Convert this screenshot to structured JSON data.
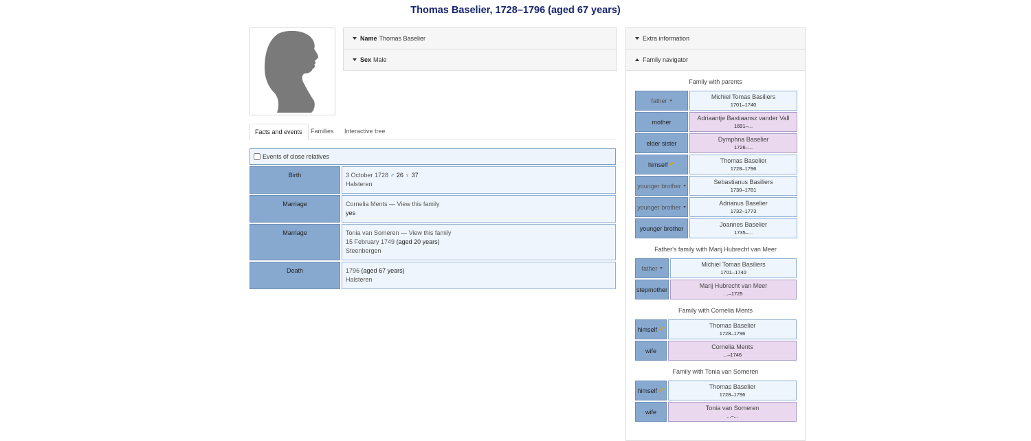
{
  "page_title": "Thomas Baselier, 1728–1796 (aged 67 years)",
  "attributes": [
    {
      "label": "Name",
      "value": "Thomas Baselier"
    },
    {
      "label": "Sex",
      "value": "Male"
    }
  ],
  "tabs": [
    "Facts and events",
    "Families",
    "Interactive tree"
  ],
  "close_relatives_label": "Events of close relatives",
  "facts": {
    "birth": {
      "label": "Birth",
      "date": "3 October 1728",
      "father_age": "26",
      "mother_age": "37",
      "place": "Halsteren"
    },
    "marriage1": {
      "label": "Marriage",
      "spouse": "Cornelia Ments",
      "sep": " — ",
      "link": "View this family",
      "status": "yes"
    },
    "marriage2": {
      "label": "Marriage",
      "spouse": "Tonia van Someren",
      "sep": " — ",
      "link": "View this family",
      "date": "15 February 1749",
      "age": "(aged 20 years)",
      "place": "Steenbergen"
    },
    "death": {
      "label": "Death",
      "date": "1796",
      "age": "(aged 67 years)",
      "place": "Halsteren"
    }
  },
  "sidebar": {
    "extra_info": "Extra information",
    "family_navigator": "Family navigator",
    "families": [
      {
        "title": "Family with parents",
        "members": [
          {
            "role": "father",
            "name": "Michiel Tomas Basiliers",
            "dates": "1701–1740"
          },
          {
            "role": "mother",
            "name": "Adriaantje Bastiaansz vander Vall",
            "dates": "1691–..."
          },
          {
            "role": "elder sister",
            "name": "Dymphna Baselier",
            "dates": "1726–..."
          },
          {
            "role": "himself",
            "name": "Thomas Baselier",
            "dates": "1728–1796"
          },
          {
            "role": "younger brother",
            "name": "Sebastianus Basiliers",
            "dates": "1730–1781"
          },
          {
            "role": "younger brother",
            "name": "Adrianus Baselier",
            "dates": "1732–1773"
          },
          {
            "role": "younger brother",
            "name": "Joannes Baselier",
            "dates": "1735–..."
          }
        ]
      },
      {
        "title": "Father's family with Marij Hubrecht van Meer",
        "members": [
          {
            "role": "father",
            "name": "Michiel Tomas Basiliers",
            "dates": "1701–1740"
          },
          {
            "role": "stepmother",
            "name": "Marij Hubrecht van Meer",
            "dates": "...–1725"
          }
        ]
      },
      {
        "title": "Family with Cornelia Ments",
        "members": [
          {
            "role": "himself",
            "name": "Thomas Baselier",
            "dates": "1728–1796"
          },
          {
            "role": "wife",
            "name": "Cornelia Ments",
            "dates": "...–1746"
          }
        ]
      },
      {
        "title": "Family with Tonia van Someren",
        "members": [
          {
            "role": "himself",
            "name": "Thomas Baselier",
            "dates": "1728–1796"
          },
          {
            "role": "wife",
            "name": "Tonia van Someren",
            "dates": "...–..."
          }
        ]
      }
    ]
  }
}
